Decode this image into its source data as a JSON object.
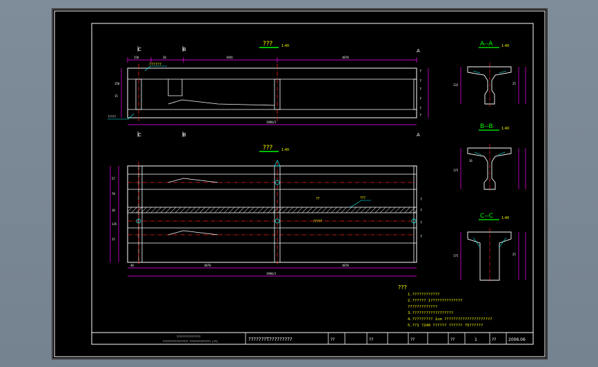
{
  "colors": {
    "frame": "#ffffff",
    "dimension": "#ff00ff",
    "centerline": "#ff2020",
    "leader": "#00ffff",
    "text": "#ffff00",
    "accent": "#00ff00",
    "hatch": "#e0e0e0"
  },
  "elevation": {
    "title": "???",
    "scale": "1:40",
    "top_dims": [
      "150",
      "20",
      "3945",
      "4870"
    ],
    "overall_dim": "1990/2",
    "left_dims": [
      "150",
      "15"
    ],
    "right_labels": [
      "?",
      "?",
      "?",
      "?",
      "?",
      "?"
    ],
    "section_left": "C",
    "section_mid": "B",
    "section_right": "A",
    "left_callout": "?????",
    "top_callout": "??????"
  },
  "plan": {
    "title": "???",
    "scale": "1:40",
    "bottom_dims": [
      "40",
      "4870",
      "4870"
    ],
    "overall_dim": "1990/2",
    "left_dims": [
      "57",
      "70",
      "10",
      "135",
      "15"
    ],
    "right_labels": [
      "?",
      "?",
      "?",
      "?"
    ],
    "center_label": "??",
    "hatch_callout": "???",
    "lower_callout": "?????"
  },
  "sections": [
    {
      "title": "A--A",
      "scale": "1:40",
      "labels": [
        "132",
        "25"
      ]
    },
    {
      "title": "B--B",
      "scale": "1:40",
      "labels": [
        "16",
        "175"
      ]
    },
    {
      "title": "C--C",
      "scale": "1:40",
      "labels": [
        "175",
        "25"
      ]
    }
  ],
  "notes": {
    "heading": "???",
    "lines": [
      "1.????????????",
      "2.?????? 1??????????????",
      "  ?????????????",
      "3.??????????????????",
      "4.?????????  1cm   ?????????????????????",
      "5.??1  ?240    ??????    ??????    ?5??????"
    ]
  },
  "title_block": {
    "org_line1": "????????????????",
    "org_line2": "????????????????? ?????????????? (??)",
    "drawing_title": "???????T?????????",
    "design_label": "??",
    "review_label": "??",
    "check_label": "??",
    "sheet_no_label": "??",
    "sheet_no": "1",
    "date_label": "??",
    "date": "2006.06"
  }
}
